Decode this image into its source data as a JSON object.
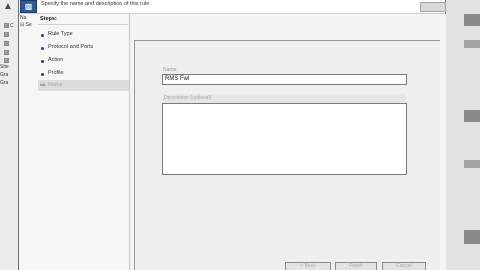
{
  "background_window": {
    "tree": [
      {
        "expander": "⊞",
        "label": "C"
      },
      {
        "expander": "⊞",
        "label": ""
      },
      {
        "expander": "⊞",
        "label": ""
      },
      {
        "expander": "⊞",
        "label": ""
      },
      {
        "expander": "⊞",
        "label": ""
      },
      {
        "expander": "",
        "label": "Site"
      },
      {
        "expander": "",
        "label": "Gra"
      },
      {
        "expander": "",
        "label": "Gra"
      }
    ]
  },
  "wizard": {
    "header_text": "Specify the name and description of this rule",
    "mini_tree": [
      "Na",
      "⊟ Se"
    ],
    "steps_title": "Steps:",
    "steps": [
      {
        "label": "Rule Type"
      },
      {
        "label": "Protocol and Ports"
      },
      {
        "label": "Action"
      },
      {
        "label": "Profile"
      }
    ],
    "current_step": {
      "label": "Name"
    },
    "form": {
      "name_label": "Name:",
      "name_value": "RMS Fwl",
      "description_label": "Description (optional):",
      "description_value": ""
    },
    "buttons": {
      "back": "< Back",
      "finish": "Finish",
      "cancel": "Cancel"
    }
  }
}
